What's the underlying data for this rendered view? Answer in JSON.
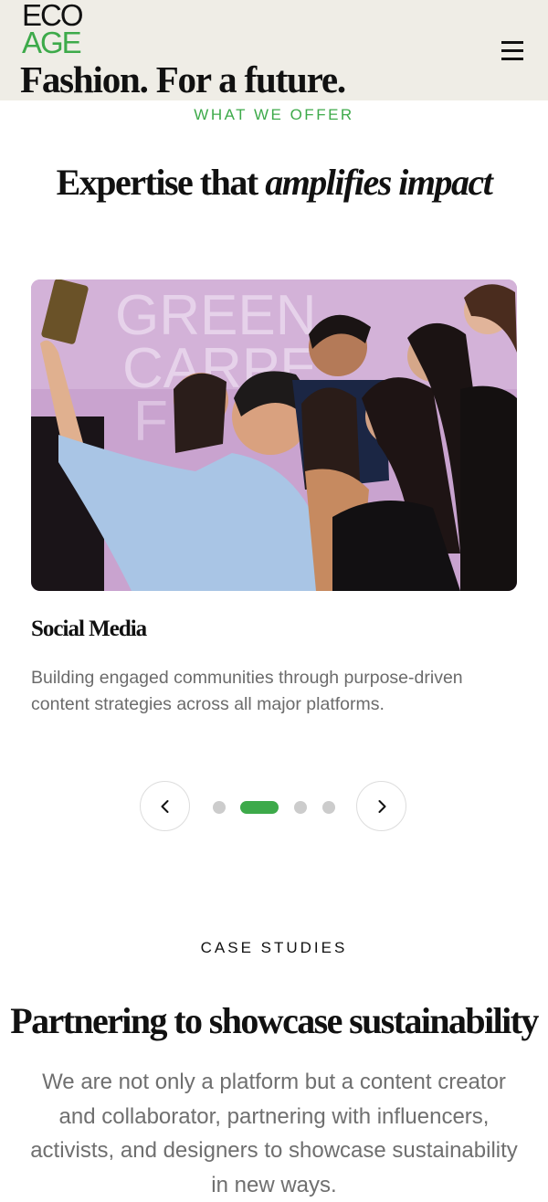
{
  "header": {
    "logo_line1": "ECO",
    "logo_line2": "AGE",
    "tagline": "Fashion. For a future.",
    "menu_icon": "hamburger-menu-icon"
  },
  "offer": {
    "eyebrow": "WHAT WE OFFER",
    "title_plain": "Expertise that ",
    "title_italic": "amplifies impact",
    "card": {
      "image_description_icon": "photo",
      "image_text": "GREEN CARPET F",
      "title": "Social Media",
      "description": "Building engaged communities through purpose-driven content strategies across all major platforms."
    },
    "carousel": {
      "prev_icon": "chevron-left-icon",
      "next_icon": "chevron-right-icon",
      "slide_count": 4,
      "active_index": 1
    }
  },
  "case_studies": {
    "eyebrow": "CASE STUDIES",
    "title": "Partnering to showcase sustainability",
    "description": "We are not only a platform but a content creator and collaborator, partnering with influencers, activists, and designers to showcase sustainability in new ways."
  },
  "colors": {
    "brand_green": "#3daa4a",
    "header_bg": "#efede6",
    "text_dark": "#111111",
    "text_muted": "#6b6b6b"
  }
}
